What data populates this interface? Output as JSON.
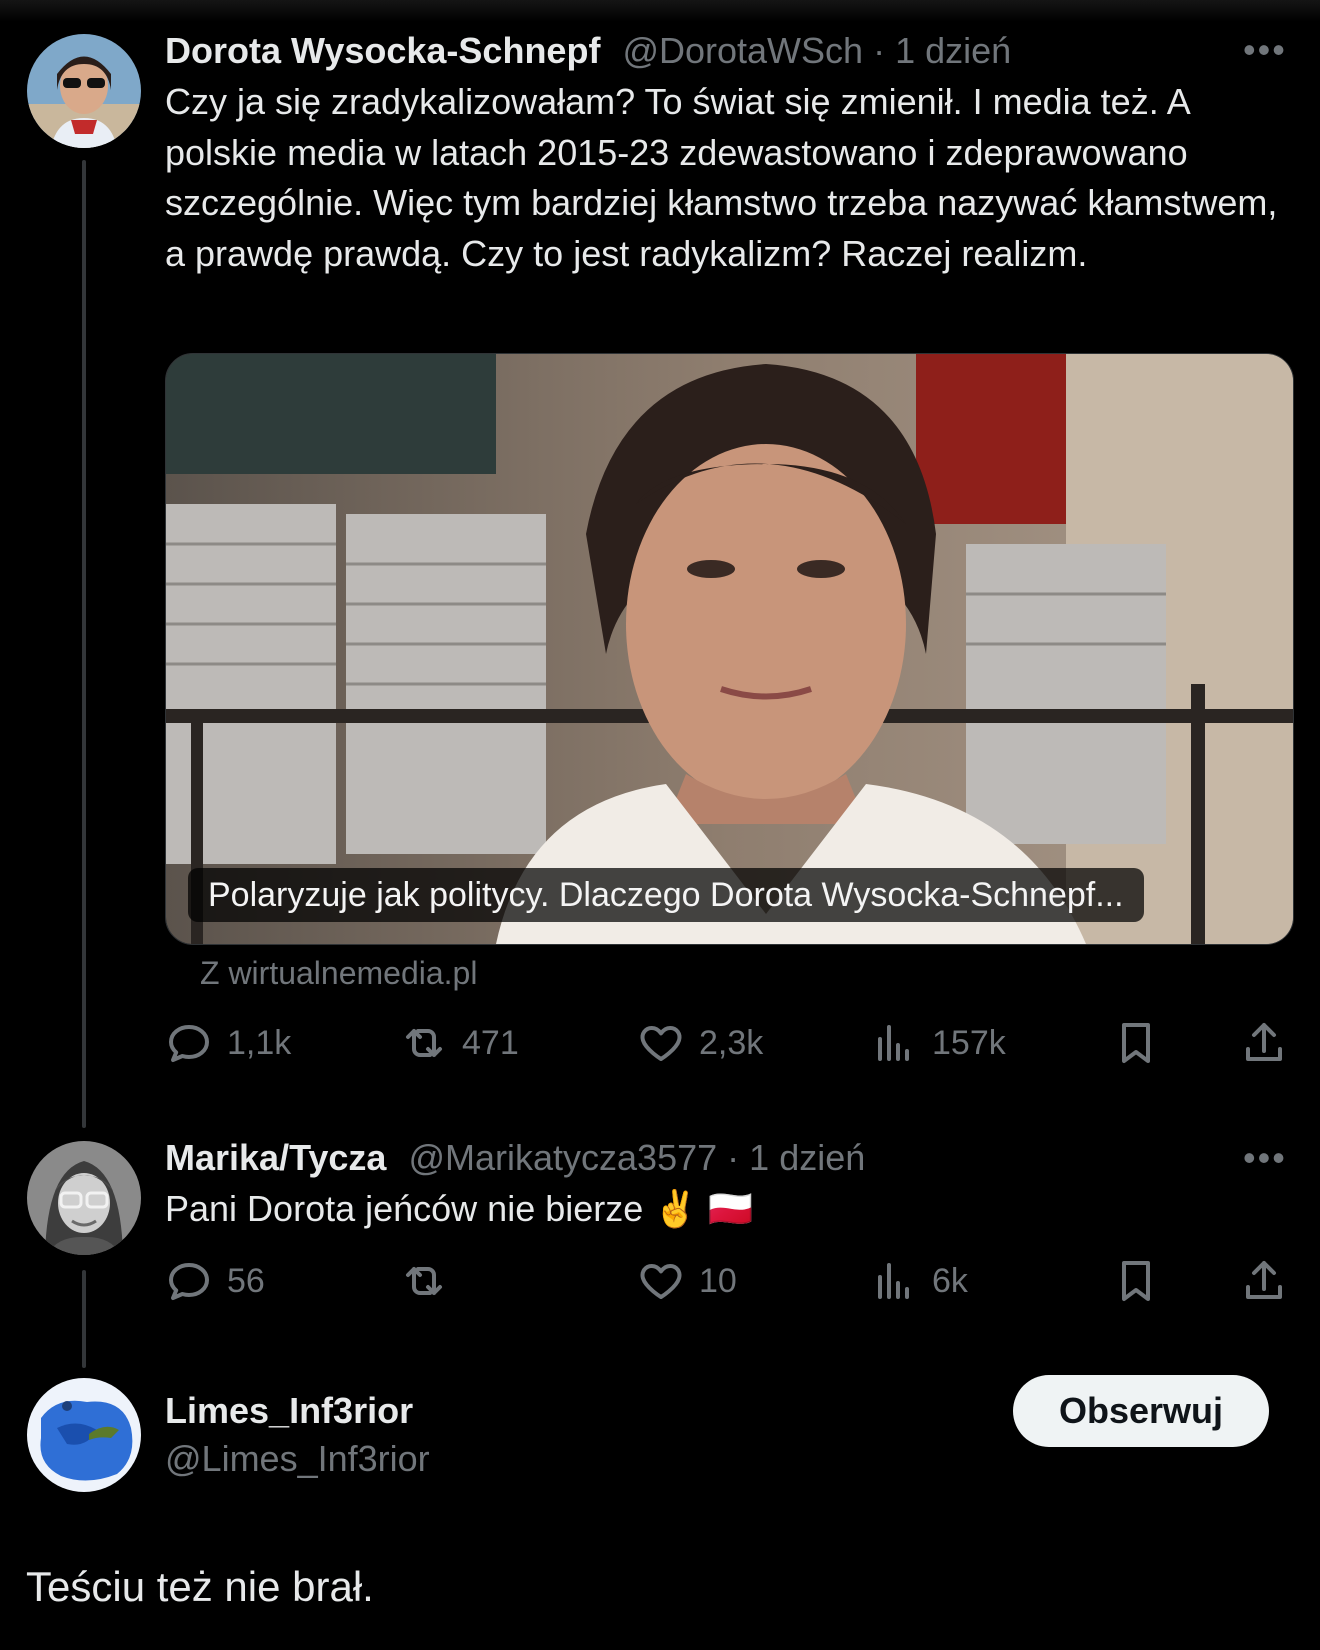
{
  "tweets": [
    {
      "name": "Dorota Wysocka-Schnepf",
      "handle": "@DorotaWSch",
      "separator": "·",
      "time": "1 dzień",
      "more": "•••",
      "text": "Czy ja się zradykalizowałam? To świat się zmienił. I media też. A polskie media w latach 2015-23 zdewastowano i zdeprawowano szczególnie. Więc tym bardziej kłamstwo trzeba nazywać kłamstwem, a prawdę prawdą. Czy to jest radykalizm? Raczej realizm.",
      "card": {
        "caption": "Polaryzuje jak politycy. Dlaczego Dorota Wysocka-Schnepf...",
        "source": "Z wirtualnemedia.pl"
      },
      "actions": {
        "replies": "1,1k",
        "reposts": "471",
        "likes": "2,3k",
        "views": "157k"
      }
    },
    {
      "name": "Marika/Tycza",
      "handle": "@Marikatycza3577",
      "separator": "·",
      "time": "1 dzień",
      "more": "•••",
      "text": "Pani Dorota jeńców nie bierze ✌️ 🇵🇱",
      "actions": {
        "replies": "56",
        "reposts": "",
        "likes": "10",
        "views": "6k"
      }
    }
  ],
  "profile": {
    "name": "Limes_Inf3rior",
    "handle": "@Limes_Inf3rior",
    "follow_label": "Obserwuj"
  },
  "reply": {
    "text": "Teściu też nie brał."
  },
  "colors": {
    "background": "#000000",
    "text": "#e7e9ea",
    "muted": "#71767b",
    "line": "#333639"
  }
}
